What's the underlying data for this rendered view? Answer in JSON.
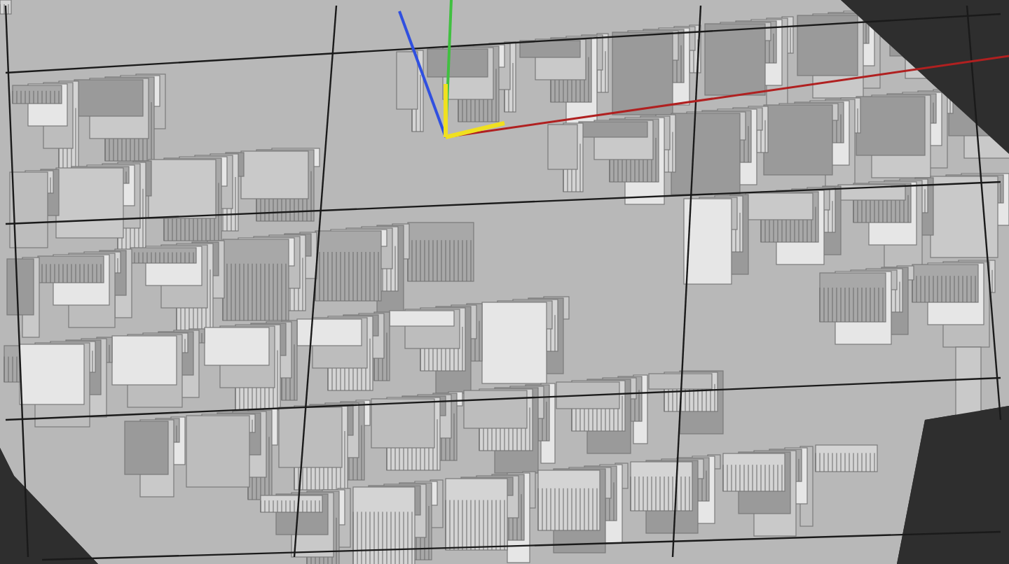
{
  "viewport": {
    "grid": true,
    "axis_gizmo": true
  }
}
